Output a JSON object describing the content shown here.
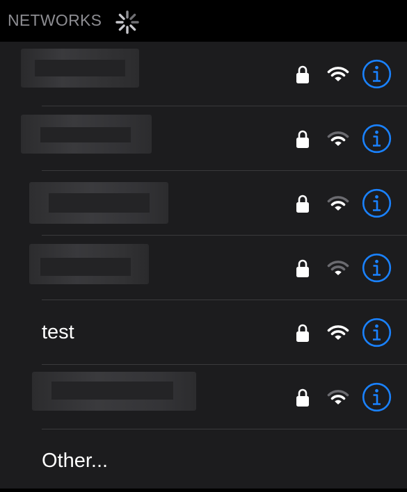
{
  "header": {
    "title": "NETWORKS"
  },
  "colors": {
    "accent": "#1a82ff",
    "background": "#1c1c1e",
    "header_background": "#000000",
    "separator": "#3a3a3c",
    "text": "#ffffff",
    "header_text": "#8d8d92"
  },
  "networks": [
    {
      "name": "",
      "obscured": true,
      "secured": true,
      "signal_bars": 3,
      "signal_bars_max": 3
    },
    {
      "name": "",
      "obscured": true,
      "secured": true,
      "signal_bars": 2,
      "signal_bars_max": 3
    },
    {
      "name": "",
      "obscured": true,
      "secured": true,
      "signal_bars": 2,
      "signal_bars_max": 3
    },
    {
      "name": "",
      "obscured": true,
      "secured": true,
      "signal_bars": 1,
      "signal_bars_max": 3
    },
    {
      "name": "test",
      "obscured": false,
      "secured": true,
      "signal_bars": 3,
      "signal_bars_max": 3
    },
    {
      "name": "",
      "obscured": true,
      "secured": true,
      "signal_bars": 2,
      "signal_bars_max": 3
    }
  ],
  "other": {
    "label": "Other..."
  },
  "icons": {
    "status": "loading-spinner-icon",
    "lock": "lock-icon",
    "wifi": "wifi-icon",
    "info": "info-icon"
  }
}
